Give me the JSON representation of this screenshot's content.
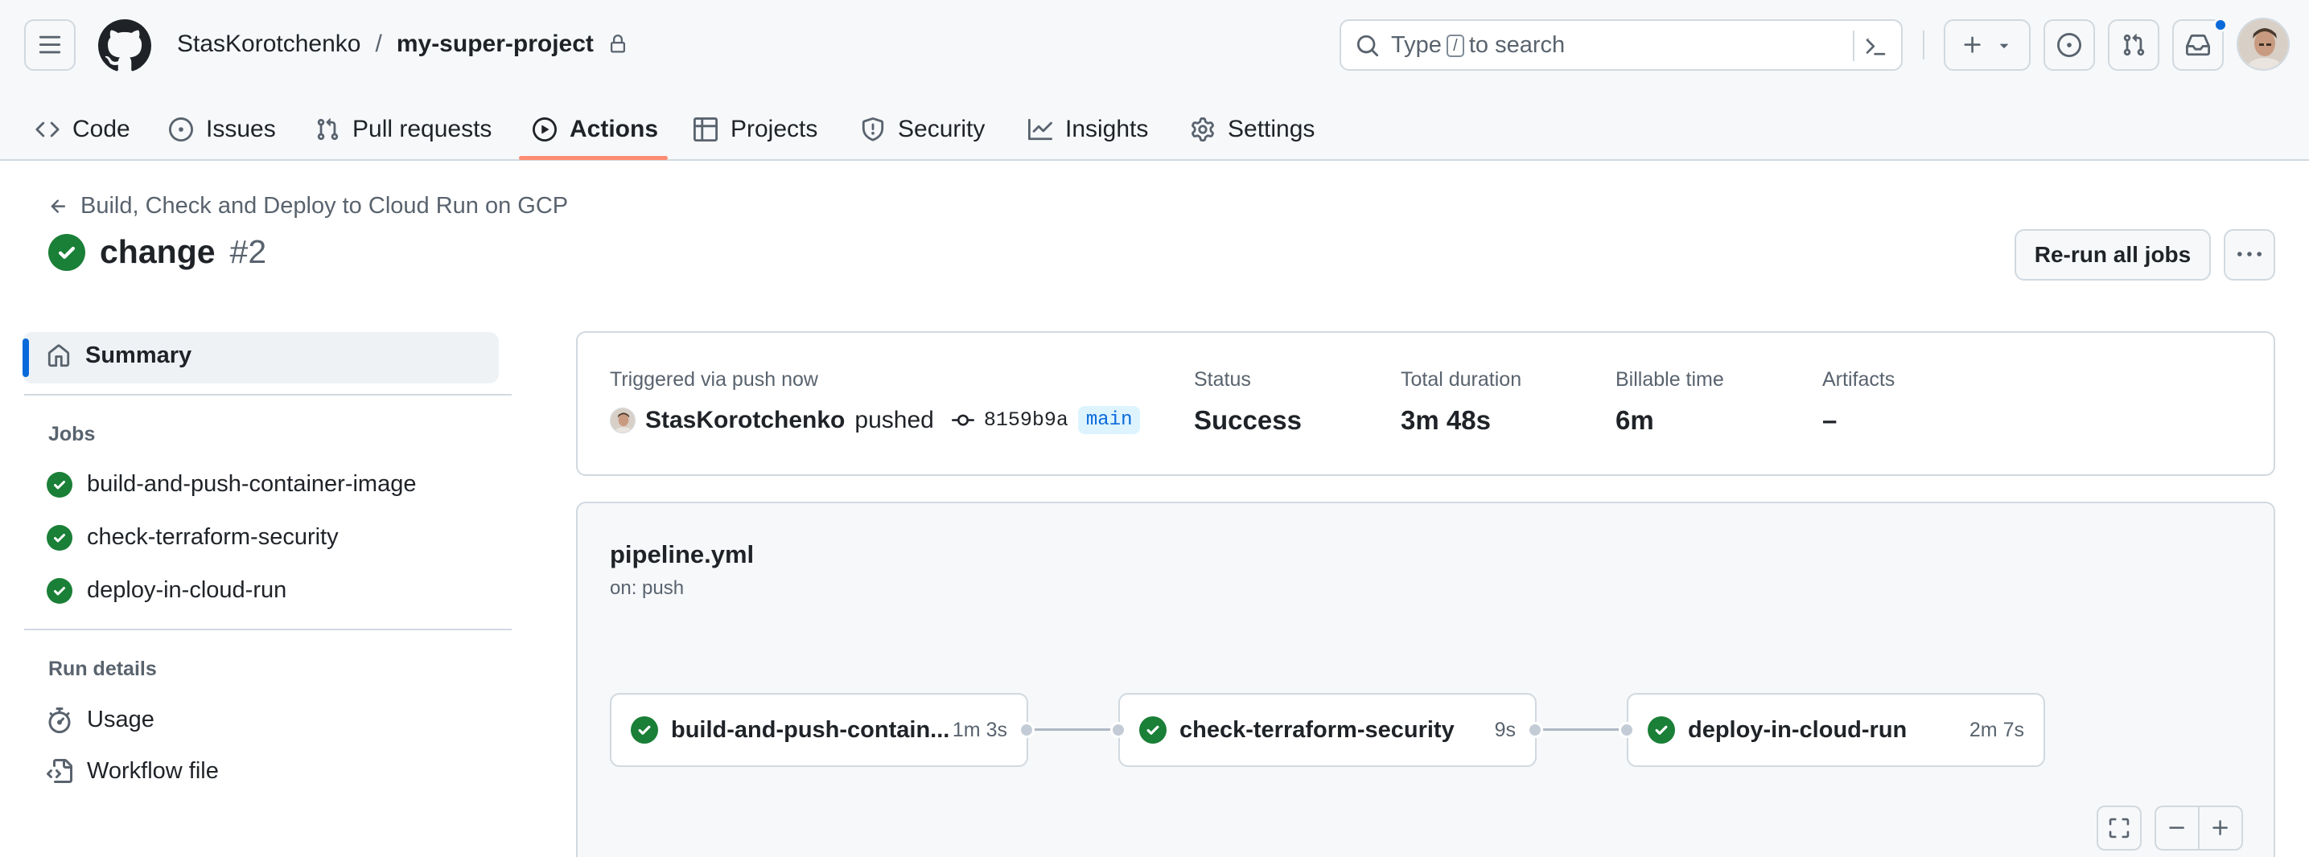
{
  "header": {
    "owner": "StasKorotchenko",
    "separator": "/",
    "repo": "my-super-project",
    "search_prefix": "Type",
    "search_key": "/",
    "search_suffix": "to search"
  },
  "tabs": [
    {
      "label": "Code",
      "icon": "code-icon"
    },
    {
      "label": "Issues",
      "icon": "issue-icon"
    },
    {
      "label": "Pull requests",
      "icon": "pull-request-icon"
    },
    {
      "label": "Actions",
      "icon": "play-icon",
      "active": true
    },
    {
      "label": "Projects",
      "icon": "table-icon"
    },
    {
      "label": "Security",
      "icon": "shield-icon"
    },
    {
      "label": "Insights",
      "icon": "graph-icon"
    },
    {
      "label": "Settings",
      "icon": "gear-icon"
    }
  ],
  "run": {
    "workflow_link": "Build, Check and Deploy to Cloud Run on GCP",
    "title": "change",
    "number": "#2",
    "rerun_label": "Re-run all jobs"
  },
  "sidebar": {
    "summary": "Summary",
    "jobs_heading": "Jobs",
    "jobs": [
      "build-and-push-container-image",
      "check-terraform-security",
      "deploy-in-cloud-run"
    ],
    "details_heading": "Run details",
    "details": [
      "Usage",
      "Workflow file"
    ]
  },
  "summary_card": {
    "trigger": "Triggered via push now",
    "actor": "StasKorotchenko",
    "action": "pushed",
    "commit": "8159b9a",
    "branch": "main",
    "status_label": "Status",
    "status_value": "Success",
    "duration_label": "Total duration",
    "duration_value": "3m 48s",
    "billable_label": "Billable time",
    "billable_value": "6m",
    "artifacts_label": "Artifacts",
    "artifacts_value": "–"
  },
  "graph": {
    "file": "pipeline.yml",
    "trigger": "on: push",
    "jobs": [
      {
        "name": "build-and-push-contain...",
        "duration": "1m 3s"
      },
      {
        "name": "check-terraform-security",
        "duration": "9s"
      },
      {
        "name": "deploy-in-cloud-run",
        "duration": "2m 7s"
      }
    ]
  },
  "colors": {
    "success": "#1a7f37",
    "accent_underline": "#fd8c73",
    "link_blue": "#0969da",
    "notification_dot": "#0969da"
  }
}
